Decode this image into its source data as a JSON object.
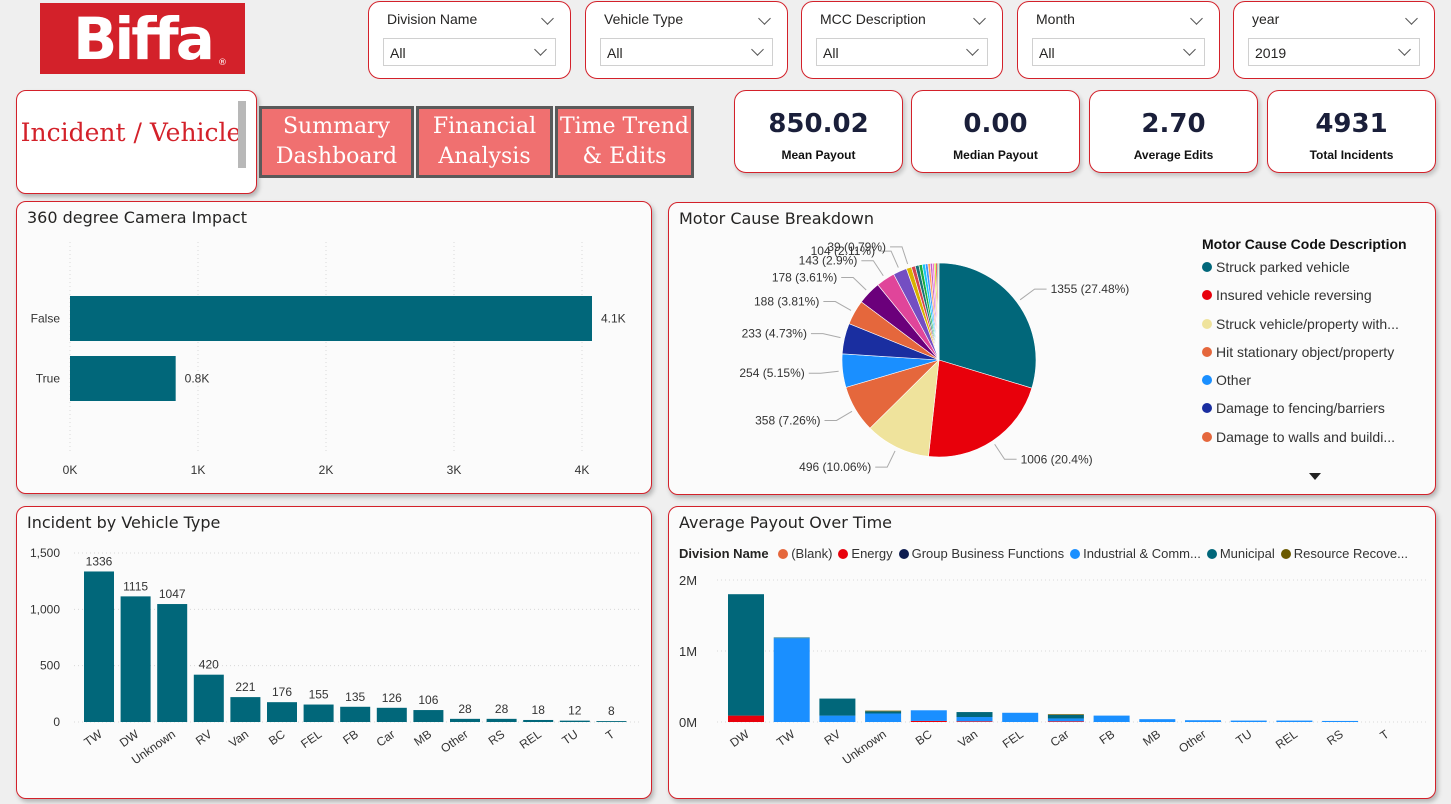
{
  "logo": {
    "text": "Biffa",
    "reg": "®"
  },
  "slicers": [
    {
      "title": "Division Name",
      "value": "All"
    },
    {
      "title": "Vehicle Type",
      "value": "All"
    },
    {
      "title": "MCC Description",
      "value": "All"
    },
    {
      "title": "Month",
      "value": "All"
    },
    {
      "title": "year",
      "value": "2019"
    }
  ],
  "nav": {
    "current": "Incident / Vehicle",
    "buttons": [
      "Summary Dashboard",
      "Financial Analysis",
      "Time Trend & Edits"
    ]
  },
  "kpis": [
    {
      "value": "850.02",
      "label": "Mean Payout"
    },
    {
      "value": "0.00",
      "label": "Median Payout"
    },
    {
      "value": "2.70",
      "label": "Average Edits"
    },
    {
      "value": "4931",
      "label": "Total Incidents"
    }
  ],
  "colors": {
    "accent": "#d3212a",
    "teal": "#01677a",
    "nav_button": "#f07070"
  },
  "chart_data": [
    {
      "type": "bar",
      "title": "360 degree Camera Impact",
      "orientation": "horizontal",
      "categories": [
        "False",
        "True"
      ],
      "values": [
        4100,
        830
      ],
      "data_labels": [
        "4.1K",
        "0.8K"
      ],
      "x_ticks": [
        "0K",
        "1K",
        "2K",
        "3K",
        "4K"
      ],
      "xlim": [
        0,
        4100
      ],
      "grid": true,
      "color": "#01677a"
    },
    {
      "type": "pie",
      "title": "Motor Cause Breakdown",
      "legend_title": "Motor Cause Code Description",
      "legend_position": "right",
      "legend": [
        {
          "label": "Struck parked vehicle",
          "color": "#01677a"
        },
        {
          "label": "Insured vehicle reversing",
          "color": "#e8000b"
        },
        {
          "label": "Struck vehicle/property with...",
          "color": "#efe39c"
        },
        {
          "label": "Hit stationary object/property",
          "color": "#e5673c"
        },
        {
          "label": "Other",
          "color": "#1a8fff"
        },
        {
          "label": "Damage to fencing/barriers",
          "color": "#1a2ea0"
        },
        {
          "label": "Damage to walls and buildi...",
          "color": "#e5673c"
        }
      ],
      "slices": [
        {
          "value": 1355,
          "label": "1355 (27.48%)",
          "color": "#01677a"
        },
        {
          "value": 1006,
          "label": "1006 (20.4%)",
          "color": "#e8000b"
        },
        {
          "value": 496,
          "label": "496 (10.06%)",
          "color": "#efe39c"
        },
        {
          "value": 358,
          "label": "358 (7.26%)",
          "color": "#e5673c"
        },
        {
          "value": 254,
          "label": "254 (5.15%)",
          "color": "#1a8fff"
        },
        {
          "value": 233,
          "label": "233 (4.73%)",
          "color": "#1a2ea0"
        },
        {
          "value": 188,
          "label": "188 (3.81%)",
          "color": "#e5673c"
        },
        {
          "value": 178,
          "label": "178 (3.61%)",
          "color": "#6b007b"
        },
        {
          "value": 143,
          "label": "143 (2.9%)",
          "color": "#e0459a"
        },
        {
          "value": 104,
          "label": "104 (2.11%)",
          "color": "#744ec2"
        },
        {
          "value": 39,
          "label": "39 (0.79%)",
          "color": "#d9b300"
        },
        {
          "value": 30,
          "label": "",
          "color": "#d64550"
        },
        {
          "value": 28,
          "label": "",
          "color": "#197278"
        },
        {
          "value": 25,
          "label": "",
          "color": "#1aab40"
        },
        {
          "value": 23,
          "label": "",
          "color": "#15c6f4"
        },
        {
          "value": 20,
          "label": "",
          "color": "#4092ff"
        },
        {
          "value": 18,
          "label": "",
          "color": "#ffa058"
        },
        {
          "value": 16,
          "label": "",
          "color": "#be5dc9"
        },
        {
          "value": 14,
          "label": "",
          "color": "#f472d0"
        },
        {
          "value": 12,
          "label": "",
          "color": "#c5e100"
        },
        {
          "value": 10,
          "label": "",
          "color": "#e8000b"
        },
        {
          "value": 8,
          "label": "",
          "color": "#0f7b5d"
        },
        {
          "value": 6,
          "label": "",
          "color": "#8b4513"
        }
      ]
    },
    {
      "type": "bar",
      "title": "Incident by Vehicle Type",
      "categories": [
        "TW",
        "DW",
        "Unknown",
        "RV",
        "Van",
        "BC",
        "FEL",
        "FB",
        "Car",
        "MB",
        "Other",
        "RS",
        "REL",
        "TU",
        "T"
      ],
      "values": [
        1336,
        1115,
        1047,
        420,
        221,
        176,
        155,
        135,
        126,
        106,
        28,
        28,
        18,
        12,
        8
      ],
      "y_ticks": [
        "0",
        "500",
        "1,000",
        "1,500"
      ],
      "ylim": [
        0,
        1500
      ],
      "grid": true,
      "color": "#01677a"
    },
    {
      "type": "bar",
      "stacked": true,
      "title": "Average Payout Over Time",
      "legend_title": "Division Name",
      "legend_position": "top",
      "series": [
        {
          "name": "(Blank)",
          "color": "#e5673c",
          "values": [
            0,
            0,
            0,
            0,
            0,
            0,
            0,
            0,
            0,
            0,
            0,
            0,
            0,
            0,
            0
          ]
        },
        {
          "name": "Energy",
          "color": "#e8000b",
          "values": [
            90000,
            0,
            0,
            0,
            15000,
            10000,
            0,
            10000,
            0,
            0,
            0,
            0,
            0,
            0,
            0
          ]
        },
        {
          "name": "Group Business Functions",
          "color": "#0d1b4f",
          "values": [
            0,
            0,
            0,
            0,
            0,
            0,
            0,
            0,
            0,
            0,
            0,
            0,
            0,
            0,
            0
          ]
        },
        {
          "name": "Industrial & Comm...",
          "color": "#1a8fff",
          "values": [
            0,
            1180000,
            90000,
            120000,
            150000,
            60000,
            130000,
            40000,
            90000,
            40000,
            25000,
            20000,
            20000,
            15000,
            0
          ]
        },
        {
          "name": "Municipal",
          "color": "#01677a",
          "values": [
            1710000,
            10000,
            240000,
            30000,
            0,
            70000,
            0,
            50000,
            0,
            0,
            0,
            0,
            0,
            0,
            0
          ]
        },
        {
          "name": "Resource Recove...",
          "color": "#6b5a00",
          "values": [
            0,
            0,
            0,
            10000,
            0,
            0,
            0,
            10000,
            0,
            0,
            0,
            0,
            0,
            0,
            0
          ]
        }
      ],
      "categories": [
        "DW",
        "TW",
        "RV",
        "Unknown",
        "BC",
        "Van",
        "FEL",
        "Car",
        "FB",
        "MB",
        "Other",
        "TU",
        "REL",
        "RS",
        "T"
      ],
      "y_ticks": [
        "0M",
        "1M",
        "2M"
      ],
      "ylim": [
        0,
        2000000
      ],
      "grid": true
    }
  ]
}
